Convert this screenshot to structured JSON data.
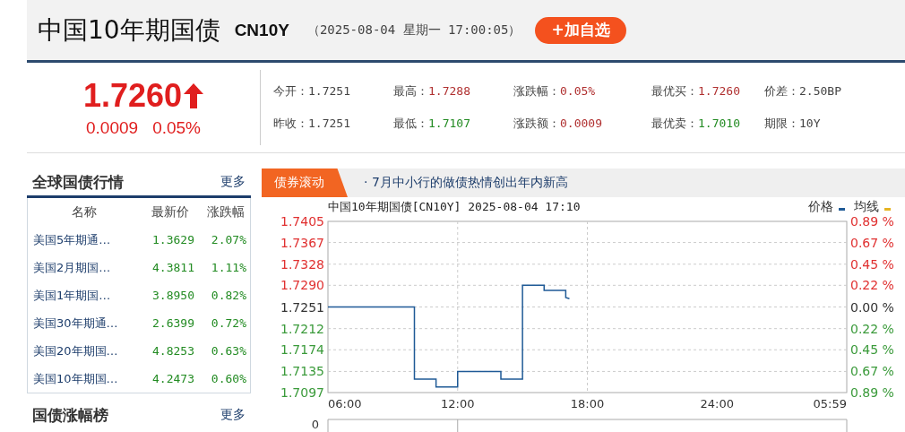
{
  "header": {
    "title": "中国10年期国债",
    "code": "CN10Y",
    "timestamp": "（2025-08-04 星期一 17:00:05）",
    "add_button": "+加自选"
  },
  "quote": {
    "price": "1.7260",
    "rising": true,
    "color": "#e01e1e",
    "change": "0.0009",
    "change_pct": "0.05%"
  },
  "stats": [
    {
      "label": "今开：",
      "value": "1.7251",
      "color": "#444444"
    },
    {
      "label": "最高：",
      "value": "1.7288",
      "color": "#b03030"
    },
    {
      "label": "涨跌幅：",
      "value": "0.05%",
      "color": "#b03030"
    },
    {
      "label": "最优买：",
      "value": "1.7260",
      "color": "#b03030"
    },
    {
      "label": "价差：",
      "value": "2.50BP",
      "color": "#444444"
    },
    {
      "label": "昨收：",
      "value": "1.7251",
      "color": "#444444"
    },
    {
      "label": "最低：",
      "value": "1.7107",
      "color": "#228b22"
    },
    {
      "label": "涨跌额：",
      "value": "0.0009",
      "color": "#b03030"
    },
    {
      "label": "最优卖：",
      "value": "1.7010",
      "color": "#228b22"
    },
    {
      "label": "期限：",
      "value": "10Y",
      "color": "#444444"
    }
  ],
  "global_bonds": {
    "title": "全球国债行情",
    "more": "更多",
    "columns": [
      "名称",
      "最新价",
      "涨跌幅"
    ],
    "rows": [
      {
        "name": "美国5年期通…",
        "price": "1.3629",
        "change": "2.07%"
      },
      {
        "name": "美国2月期国…",
        "price": "4.3811",
        "change": "1.11%"
      },
      {
        "name": "美国1年期国…",
        "price": "3.8950",
        "change": "0.82%"
      },
      {
        "name": "美国30年期通…",
        "price": "2.6399",
        "change": "0.72%"
      },
      {
        "name": "美国20年期国…",
        "price": "4.8253",
        "change": "0.63%"
      },
      {
        "name": "美国10年期国…",
        "price": "4.2473",
        "change": "0.60%"
      }
    ]
  },
  "gainers": {
    "title": "国债涨幅榜",
    "more": "更多"
  },
  "ticker": {
    "tab": "债券滚动",
    "headline": "· 7月中小行的做债热情创出年内新高"
  },
  "chart_panel": {
    "title": "中国10年期国债[CN10Y] 2025-08-04 17:10",
    "legend": [
      {
        "label": "价格",
        "color": "#1f5a96"
      },
      {
        "label": "均线",
        "color": "#e6b422"
      }
    ],
    "percent_labels": [
      {
        "text": "0.89 %",
        "color": "#e03030"
      },
      {
        "text": "0.67 %",
        "color": "#e03030"
      },
      {
        "text": "0.45 %",
        "color": "#e03030"
      },
      {
        "text": "0.22 %",
        "color": "#e03030"
      },
      {
        "text": "0.00 %",
        "color": "#333333"
      },
      {
        "text": "0.22 %",
        "color": "#3a9a3a"
      },
      {
        "text": "0.45 %",
        "color": "#3a9a3a"
      },
      {
        "text": "0.67 %",
        "color": "#3a9a3a"
      },
      {
        "text": "0.89 %",
        "color": "#3a9a3a"
      }
    ],
    "volume_label": "0",
    "x_end_label": "05:59",
    "chart_data": {
      "type": "line",
      "grid": true,
      "x": [
        6,
        10,
        10,
        11,
        11,
        12,
        12,
        14,
        14,
        15,
        15,
        16,
        16,
        17,
        17,
        17.17
      ],
      "series": [
        {
          "color": "#1f5a96",
          "values": [
            1.7251,
            1.7251,
            1.7121,
            1.7121,
            1.7107,
            1.7107,
            1.7135,
            1.7135,
            1.7121,
            1.7121,
            1.729,
            1.729,
            1.7281,
            1.7281,
            1.7268,
            1.7266
          ]
        }
      ],
      "xlim": [
        6,
        30
      ],
      "ylim": [
        1.7097,
        1.7405
      ],
      "xticks": [
        {
          "value": 6,
          "label": "06:00"
        },
        {
          "value": 12,
          "label": "12:00"
        },
        {
          "value": 18,
          "label": "18:00"
        },
        {
          "value": 24,
          "label": "24:00"
        }
      ],
      "yticks": [
        {
          "value": 1.7405,
          "label": "1.7405"
        },
        {
          "value": 1.7367,
          "label": "1.7367"
        },
        {
          "value": 1.7328,
          "label": "1.7328"
        },
        {
          "value": 1.729,
          "label": "1.7290"
        },
        {
          "value": 1.7251,
          "label": "1.7251"
        },
        {
          "value": 1.7212,
          "label": "1.7212"
        },
        {
          "value": 1.7174,
          "label": "1.7174"
        },
        {
          "value": 1.7135,
          "label": "1.7135"
        },
        {
          "value": 1.7097,
          "label": "1.7097"
        }
      ]
    }
  }
}
